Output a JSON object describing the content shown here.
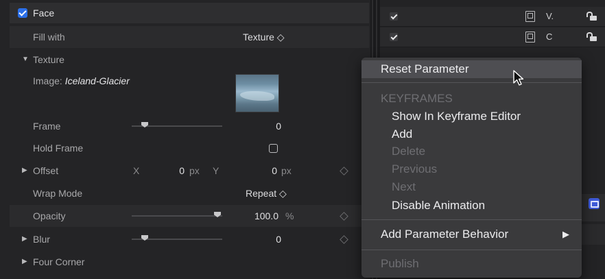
{
  "inspector": {
    "face": {
      "label": "Face",
      "checked": true
    },
    "fill_with": {
      "label": "Fill with",
      "value": "Texture ◇"
    },
    "texture": {
      "label": "Texture",
      "image_label": "Image:",
      "image_name": "Iceland-Glacier"
    },
    "frame": {
      "label": "Frame",
      "value": "0"
    },
    "hold_frame": {
      "label": "Hold Frame"
    },
    "offset": {
      "label": "Offset",
      "x_label": "X",
      "x_value": "0",
      "x_unit": "px",
      "y_label": "Y",
      "y_value": "0",
      "y_unit": "px"
    },
    "wrap_mode": {
      "label": "Wrap Mode",
      "value": "Repeat ◇"
    },
    "opacity": {
      "label": "Opacity",
      "value": "100.0",
      "unit": "%"
    },
    "blur": {
      "label": "Blur",
      "value": "0"
    },
    "four_corner": {
      "label": "Four Corner"
    }
  },
  "layers": [
    {
      "name": "V.",
      "checked": true
    },
    {
      "name": "C",
      "checked": true
    }
  ],
  "context_menu": {
    "reset": "Reset Parameter",
    "keyframes_header": "KEYFRAMES",
    "show_in_editor": "Show In Keyframe Editor",
    "add": "Add",
    "delete": "Delete",
    "previous": "Previous",
    "next": "Next",
    "disable_animation": "Disable Animation",
    "add_behavior": "Add Parameter Behavior",
    "add_behavior_arrow": "▶",
    "publish": "Publish"
  },
  "glyphs": {
    "expanded": "▼",
    "collapsed": "▶"
  },
  "colors": {
    "accent": "#2b6fe8",
    "behavior_icon": "#3f5bd9"
  }
}
